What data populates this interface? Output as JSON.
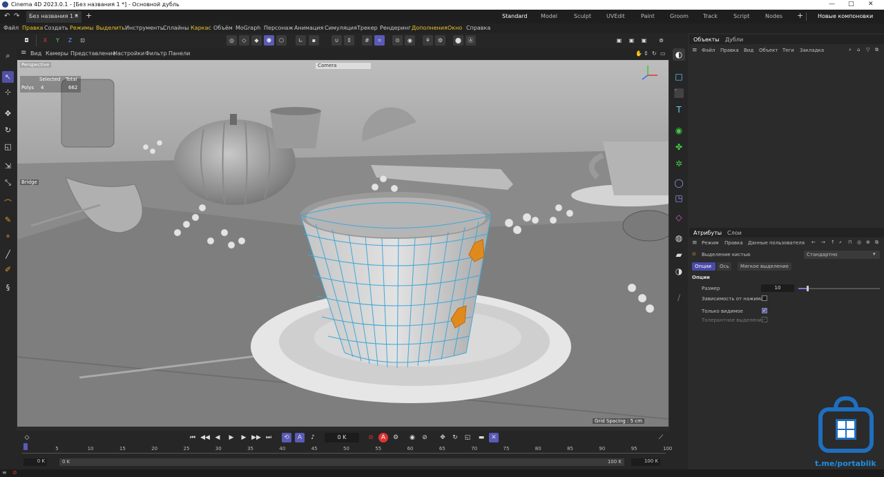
{
  "window": {
    "title": "Cinema 4D 2023.0.1 - [Без названия 1 *] - Основной дубль",
    "controls": [
      "—",
      "□",
      "✕"
    ]
  },
  "tabbar": {
    "doc_tab": "Без названия 1 *",
    "layouts": [
      "Standard",
      "Model",
      "Sculpt",
      "UVEdit",
      "Paint",
      "Groom",
      "Track",
      "Script",
      "Nodes"
    ],
    "active_layout": "Standard",
    "new_layouts": "Новые компоновки"
  },
  "menubar": {
    "items": [
      "Файл",
      "Правка",
      "Создать",
      "Режимы",
      "Выделить",
      "Инструменты",
      "Сплайны",
      "Каркас",
      "Объём",
      "MoGraph",
      "Персонаж",
      "Анимация",
      "Симуляция",
      "Трекер",
      "Рендеринг",
      "Дополнения",
      "Окно",
      "Справка"
    ],
    "highlighted": [
      "Правка",
      "Режимы",
      "Выделить",
      "Каркас",
      "Дополнения",
      "Окно"
    ]
  },
  "toolbar": {
    "axes": [
      "X",
      "Y",
      "Z"
    ]
  },
  "viewport_menu": {
    "items": [
      "Вид",
      "Камеры",
      "Представление",
      "Настройки",
      "Фильтр",
      "Панели"
    ]
  },
  "viewport": {
    "view_name": "Perspective",
    "camera": "Camera",
    "hud_selected": "Selected",
    "hud_total": "Total",
    "hud_polys_label": "Polys",
    "hud_polys_selected": "4",
    "hud_polys_total": "662",
    "bridge_label": "Bridge",
    "grid_spacing": "Grid Spacing : 5 cm"
  },
  "objects_panel": {
    "tabs": [
      "Объекты",
      "Дубли"
    ],
    "menu": [
      "Файл",
      "Правка",
      "Вид",
      "Объект",
      "Теги",
      "Закладка"
    ]
  },
  "attributes_panel": {
    "tabs": [
      "Атрибуты",
      "Слои"
    ],
    "menu": [
      "Режим",
      "Правка",
      "Данные пользователя"
    ],
    "tool_name": "Выделение кистью",
    "preset": "Стандартно",
    "subtabs": [
      "Опции",
      "Ось",
      "Мягкое выделение"
    ],
    "section": "Опции",
    "size_label": "Размер",
    "size_value": "10",
    "size_fraction": 0.1,
    "pressure_label": "Зависимость от нажима",
    "pressure_checked": false,
    "visible_only_label": "Только видимое",
    "visible_only_checked": true,
    "tolerant_label": "Толерантное выделение",
    "tolerant_checked": true
  },
  "timeline": {
    "current_frame": "0 K",
    "ruler_ticks": [
      "0",
      "5",
      "10",
      "15",
      "20",
      "25",
      "30",
      "35",
      "40",
      "45",
      "50",
      "55",
      "60",
      "65",
      "70",
      "75",
      "80",
      "85",
      "90",
      "95",
      "100"
    ],
    "range_start": "0 K",
    "range_start2": "0 K",
    "range_end": "100 K",
    "range_end2": "100 K"
  },
  "watermark": "t.me/portablik",
  "colors": {
    "accent": "#5a5ab8",
    "highlight_menu": "#e8c02a",
    "mesh": "#3fa7d6",
    "selected_poly": "#e08a1e"
  }
}
